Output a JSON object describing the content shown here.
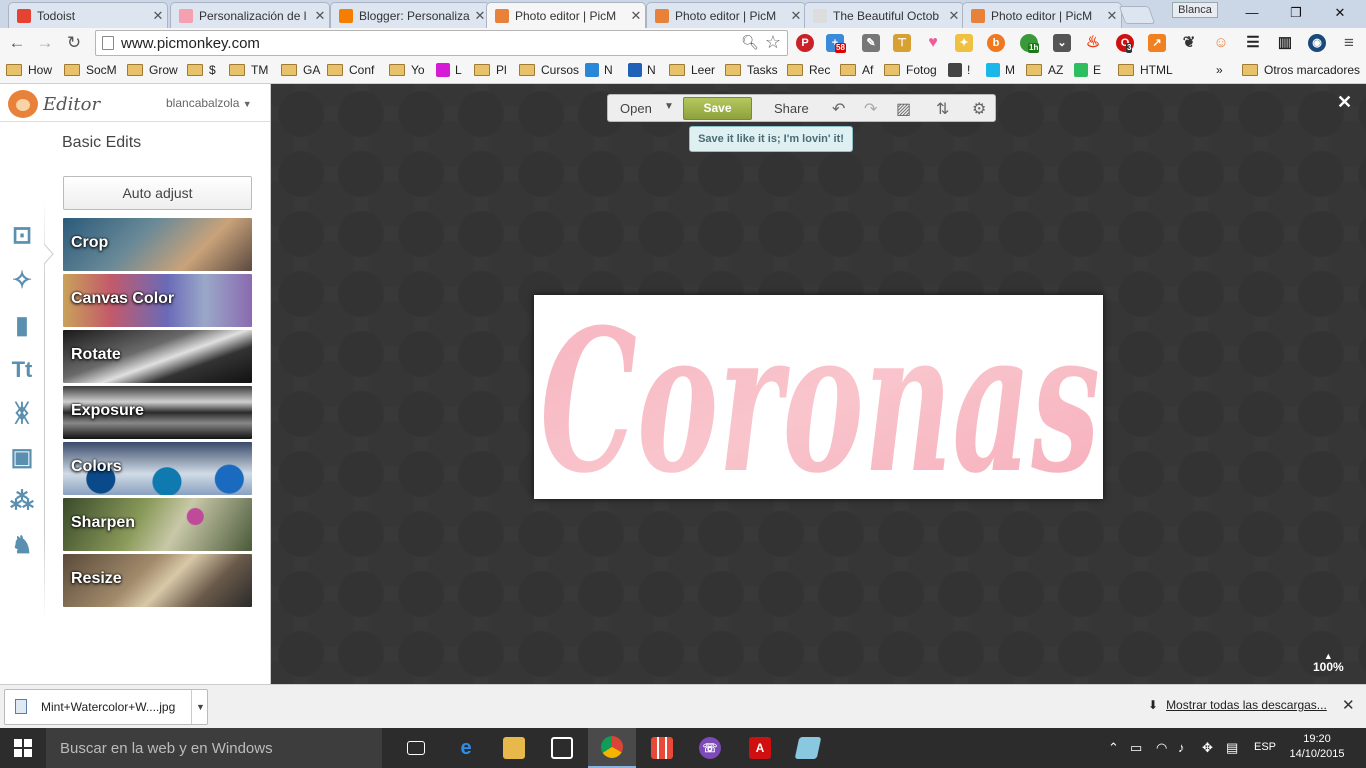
{
  "tabs": [
    {
      "title": "Todoist",
      "color": "#e44332"
    },
    {
      "title": "Personalización de l",
      "color": "#f4a0b0"
    },
    {
      "title": "Blogger: Personaliza",
      "color": "#f57d00"
    },
    {
      "title": "Photo editor | PicM",
      "color": "#e8823a",
      "active": true
    },
    {
      "title": "Photo editor | PicM",
      "color": "#e8823a"
    },
    {
      "title": "The Beautiful Octob",
      "color": "#dddddd"
    },
    {
      "title": "Photo editor | PicM",
      "color": "#e8823a"
    }
  ],
  "profile_name": "Blanca",
  "url": "www.picmonkey.com",
  "extension_badges": {
    "badge_1": "58",
    "badge_2": "1h",
    "badge_3": "3"
  },
  "bookmarks": [
    {
      "label": "How",
      "type": "folder"
    },
    {
      "label": "SocM",
      "type": "folder"
    },
    {
      "label": "Grow",
      "type": "folder"
    },
    {
      "label": "$",
      "type": "folder"
    },
    {
      "label": "TM",
      "type": "folder"
    },
    {
      "label": "GA",
      "type": "folder"
    },
    {
      "label": "Conf",
      "type": "folder"
    },
    {
      "label": "Yo",
      "type": "folder"
    },
    {
      "label": "L",
      "type": "site",
      "color": "#d61bd6"
    },
    {
      "label": "Pl",
      "type": "folder"
    },
    {
      "label": "Cursos",
      "type": "folder"
    },
    {
      "label": "N",
      "type": "site",
      "color": "#2a86d6"
    },
    {
      "label": "N",
      "type": "site",
      "color": "#2061b8"
    },
    {
      "label": "Leer",
      "type": "folder"
    },
    {
      "label": "Tasks",
      "type": "folder"
    },
    {
      "label": "Rec",
      "type": "folder"
    },
    {
      "label": "Af",
      "type": "folder"
    },
    {
      "label": "Fotog",
      "type": "folder"
    },
    {
      "label": "!",
      "type": "site",
      "color": "#444444"
    },
    {
      "label": "M",
      "type": "site",
      "color": "#1ab7ea"
    },
    {
      "label": "AZ",
      "type": "folder"
    },
    {
      "label": "E",
      "type": "site",
      "color": "#2dbe60"
    },
    {
      "label": "HTML",
      "type": "folder"
    }
  ],
  "bookmarks_more": "»",
  "other_bookmarks": "Otros marcadores",
  "editor": {
    "logo_text": "Editor",
    "username": "blancabalzola",
    "section_title": "Basic Edits",
    "auto_adjust_label": "Auto adjust",
    "tools": [
      {
        "label": "Crop",
        "bg": "linear-gradient(135deg,#2b5a7a,#6a8a98 40%,#c9a27a 70%,#5a4a40)"
      },
      {
        "label": "Canvas Color",
        "bg": "linear-gradient(90deg,#c9a25a,#c35a6a 25%,#6a6ab8 55%,#9aa8c8 75%,#8a6ab0)"
      },
      {
        "label": "Rotate",
        "bg": "linear-gradient(160deg,#1a1a1a,#6a6a6a 40%,#e0e0e0 55%,#333 70%,#111)"
      },
      {
        "label": "Exposure",
        "bg": "linear-gradient(180deg,#3a3a3a,#cfcfcf 30%,#2a2a2a 50%,#888 70%,#111)"
      },
      {
        "label": "Colors",
        "bg": "radial-gradient(circle at 20% 70%,#0a4a8a 0 14px,transparent 15px),radial-gradient(circle at 55% 75%,#0e7ab0 0 14px,transparent 15px),radial-gradient(circle at 88% 70%,#1a6ac0 0 14px,transparent 15px),linear-gradient(#3a4a6a,#d0dbe6 60%,#8aa0c0)"
      },
      {
        "label": "Sharpen",
        "bg": "radial-gradient(circle at 70% 35%,#c04a9a 0 8px,transparent 9px),linear-gradient(120deg,#3a4a2a,#8a9a5a 40%,#c8c8a8 60%,#4a5a3a)"
      },
      {
        "label": "Resize",
        "bg": "linear-gradient(135deg,#5a4a3a,#a08a6a 40%,#d8c8a8 55%,#6a5a4a 75%,#2a2a2a)"
      }
    ],
    "open_label": "Open",
    "save_label": "Save",
    "share_label": "Share",
    "tooltip": "Save it like it is;  I'm lovin' it!",
    "zoom_level": "100%",
    "photo_text": "Coronas"
  },
  "download": {
    "filename": "Mint+Watercolor+W....jpg",
    "show_all": "Mostrar todas las descargas..."
  },
  "taskbar": {
    "search_placeholder": "Buscar en la web y en Windows",
    "language": "ESP",
    "time": "19:20",
    "date": "14/10/2015"
  }
}
